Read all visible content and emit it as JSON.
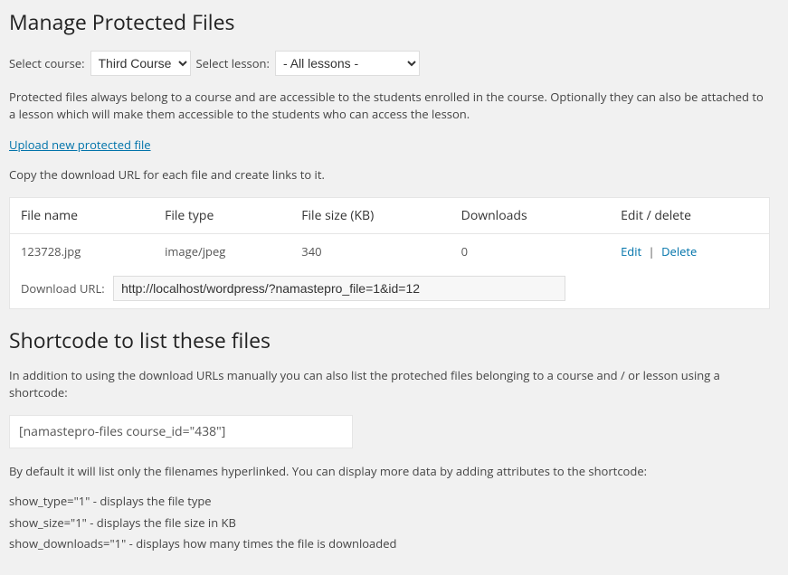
{
  "page_title": "Manage Protected Files",
  "course_label": "Select course:",
  "course_value": "Third Course",
  "lesson_label": "Select lesson:",
  "lesson_value": "- All lessons -",
  "intro_text": "Protected files always belong to a course and are accessible to the students enrolled in the course. Optionally they can also be attached to a lesson which will make them accessible to the students who can access the lesson.",
  "upload_link": "Upload new protected file",
  "copy_text": "Copy the download URL for each file and create links to it.",
  "table": {
    "headers": {
      "name": "File name",
      "type": "File type",
      "size": "File size (KB)",
      "downloads": "Downloads",
      "actions": "Edit / delete"
    },
    "row": {
      "name": "123728.jpg",
      "type": "image/jpeg",
      "size": "340",
      "downloads": "0",
      "edit": "Edit",
      "delete": "Delete"
    },
    "url_label": "Download URL:",
    "url_value": "http://localhost/wordpress/?namastepro_file=1&id=12"
  },
  "shortcode_heading": "Shortcode to list these files",
  "shortcode_intro": "In addition to using the download URLs manually you can also list the proteched files belonging to a course and / or lesson using a shortcode:",
  "shortcode_value": "[namastepro-files course_id=\"438\"]",
  "shortcode_default": "By default it will list only the filenames hyperlinked. You can display more data by adding attributes to the shortcode:",
  "attr_type": "show_type=\"1\" - displays the file type",
  "attr_size": "show_size=\"1\" - displays the file size in KB",
  "attr_downloads": "show_downloads=\"1\" - displays how many times the file is downloaded"
}
